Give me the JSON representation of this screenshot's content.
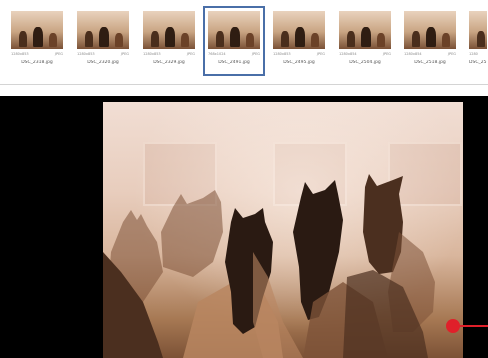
{
  "filmstrip": {
    "thumbnails": [
      {
        "filename": "DSC_2318.jpg",
        "dimensions": "1280x853",
        "type": "JPEG",
        "selected": false
      },
      {
        "filename": "DSC_2320.jpg",
        "dimensions": "1280x853",
        "type": "JPEG",
        "selected": false
      },
      {
        "filename": "DSC_2329.jpg",
        "dimensions": "1280x853",
        "type": "JPEG",
        "selected": false
      },
      {
        "filename": "DSC_2491.jpg",
        "dimensions": "768x1024",
        "type": "JPEG",
        "selected": true
      },
      {
        "filename": "DSC_2495.jpg",
        "dimensions": "1280x853",
        "type": "JPEG",
        "selected": false
      },
      {
        "filename": "DSC_2504.jpg",
        "dimensions": "1280x854",
        "type": "JPEG",
        "selected": false
      },
      {
        "filename": "DSC_2518.jpg",
        "dimensions": "1280x854",
        "type": "JPEG",
        "selected": false
      },
      {
        "filename": "DSC_25",
        "dimensions": "1280",
        "type": "",
        "selected": false
      }
    ]
  },
  "viewer": {
    "image_subject": "horses"
  },
  "colors": {
    "selection_border": "#4a6fa8",
    "viewer_background": "#000000",
    "marker": "#e0202a"
  },
  "icons": {
    "marker": "red-dot-callout"
  }
}
